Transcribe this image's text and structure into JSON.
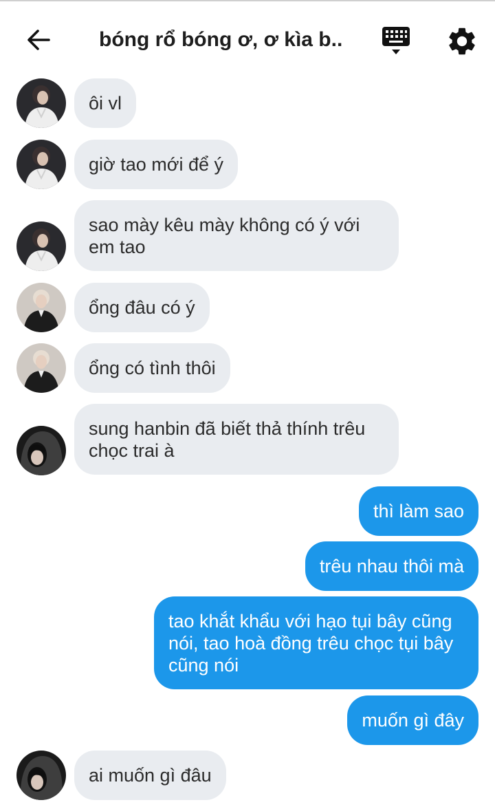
{
  "header": {
    "title": "bóng rổ bóng ơ, ơ kìa b...",
    "back_icon": "arrow-left-icon",
    "keyboard_icon": "keyboard-icon",
    "settings_icon": "gear-icon"
  },
  "colors": {
    "incoming_bubble": "#e9ecf0",
    "outgoing_bubble": "#1c97ea",
    "incoming_text": "#2b2b2b",
    "outgoing_text": "#ffffff"
  },
  "messages": [
    {
      "direction": "incoming",
      "sender_avatar": "avatar-white-shirt",
      "text": "ôi vl"
    },
    {
      "direction": "incoming",
      "sender_avatar": "avatar-white-shirt",
      "text": "giờ tao mới để ý"
    },
    {
      "direction": "incoming",
      "sender_avatar": "avatar-white-shirt",
      "text": "sao mày kêu mày không có ý với em tao"
    },
    {
      "direction": "incoming",
      "sender_avatar": "avatar-blonde-black-jacket",
      "text": "ổng đâu có ý"
    },
    {
      "direction": "incoming",
      "sender_avatar": "avatar-blonde-black-jacket",
      "text": "ổng có tình thôi"
    },
    {
      "direction": "incoming",
      "sender_avatar": "avatar-hooded",
      "text": "sung hanbin đã biết thả thính trêu chọc trai à"
    },
    {
      "direction": "outgoing",
      "text": "thì làm sao"
    },
    {
      "direction": "outgoing",
      "text": "trêu nhau thôi mà"
    },
    {
      "direction": "outgoing",
      "text": "tao khắt khẩu với hạo tụi bây cũng nói, tao hoà đồng trêu chọc tụi bây cũng nói"
    },
    {
      "direction": "outgoing",
      "text": "muốn gì đây"
    },
    {
      "direction": "incoming",
      "sender_avatar": "avatar-hooded",
      "text": "ai muốn gì đâu"
    }
  ]
}
